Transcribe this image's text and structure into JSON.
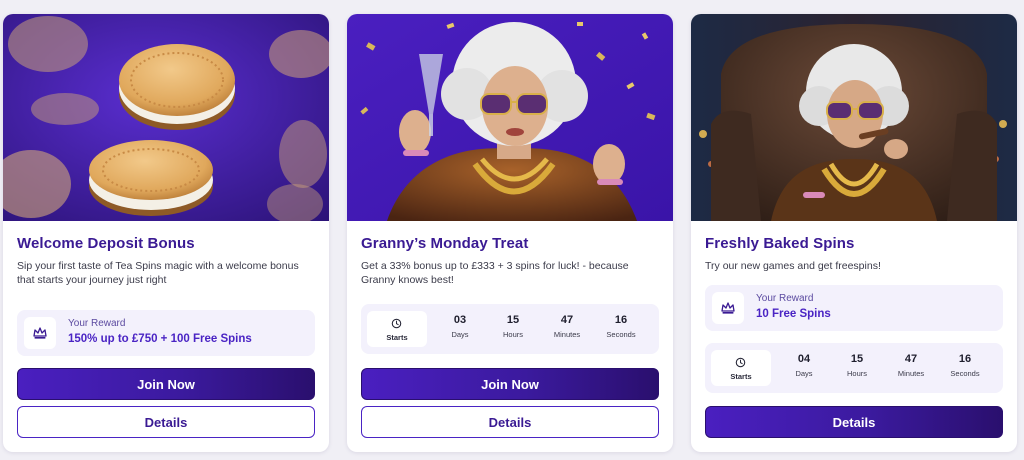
{
  "colors": {
    "brand_purple": "#3a1a93",
    "accent_purple": "#4a24c4",
    "panel_tint": "#f3f1fc"
  },
  "cards": [
    {
      "title": "Welcome Deposit Bonus",
      "description": "Sip your first taste of Tea Spins magic with a welcome bonus that starts your journey just right",
      "reward_label": "Your Reward",
      "reward_value": "150% up to £750 + 100 Free Spins",
      "join_label": "Join Now",
      "details_label": "Details",
      "image": "cookies-image"
    },
    {
      "title": "Granny’s Monday Treat",
      "description": "Get a 33% bonus up to £333 + 3 spins for luck! - because Granny knows best!",
      "timer": {
        "starts_label": "Starts",
        "days": "03",
        "days_label": "Days",
        "hours": "15",
        "hours_label": "Hours",
        "minutes": "47",
        "minutes_label": "Minutes",
        "seconds": "16",
        "seconds_label": "Seconds"
      },
      "join_label": "Join Now",
      "details_label": "Details",
      "image": "granny-champagne-image"
    },
    {
      "title": "Freshly Baked Spins",
      "description": "Try our new games and get freespins!",
      "reward_label": "Your Reward",
      "reward_value": "10 Free Spins",
      "timer": {
        "starts_label": "Starts",
        "days": "04",
        "days_label": "Days",
        "hours": "15",
        "hours_label": "Hours",
        "minutes": "47",
        "minutes_label": "Minutes",
        "seconds": "16",
        "seconds_label": "Seconds"
      },
      "details_label": "Details",
      "image": "granny-armchair-image"
    }
  ]
}
